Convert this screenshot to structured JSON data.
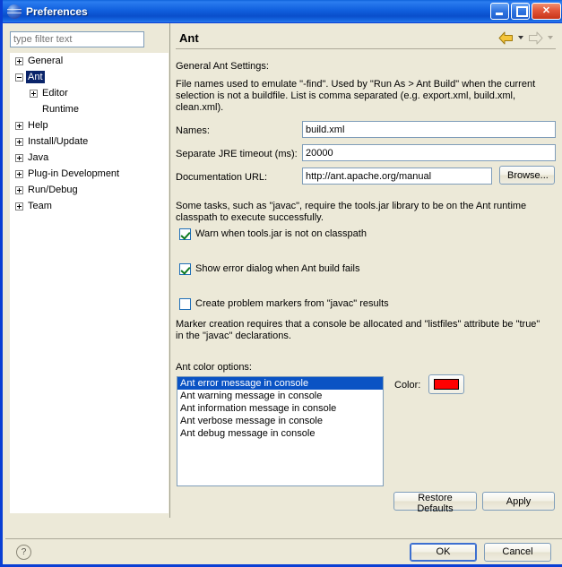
{
  "window": {
    "title": "Preferences",
    "icon": "eclipse-globe-icon",
    "minimize_label": "",
    "maximize_label": "",
    "close_label": "✕",
    "frame_color": "#0A3FD4"
  },
  "sidebar": {
    "filter": {
      "value": "",
      "placeholder": "type filter text"
    },
    "items": [
      {
        "label": "General",
        "state": "collapsed",
        "depth": 0,
        "selected": false
      },
      {
        "label": "Ant",
        "state": "expanded",
        "depth": 0,
        "selected": true
      },
      {
        "label": "Editor",
        "state": "collapsed",
        "depth": 1,
        "selected": false
      },
      {
        "label": "Runtime",
        "state": "leaf",
        "depth": 1,
        "selected": false
      },
      {
        "label": "Help",
        "state": "collapsed",
        "depth": 0,
        "selected": false
      },
      {
        "label": "Install/Update",
        "state": "collapsed",
        "depth": 0,
        "selected": false
      },
      {
        "label": "Java",
        "state": "collapsed",
        "depth": 0,
        "selected": false
      },
      {
        "label": "Plug-in Development",
        "state": "collapsed",
        "depth": 0,
        "selected": false
      },
      {
        "label": "Run/Debug",
        "state": "collapsed",
        "depth": 0,
        "selected": false
      },
      {
        "label": "Team",
        "state": "collapsed",
        "depth": 0,
        "selected": false
      }
    ]
  },
  "page": {
    "title": "Ant",
    "nav": {
      "back_icon": "back-arrow-icon",
      "back_menu_icon": "chevron-down-icon",
      "forward_icon": "forward-arrow-icon",
      "forward_menu_icon": "chevron-down-icon"
    },
    "section_label": "General Ant Settings:",
    "find_description": "File names used to emulate \"-find\". Used by \"Run As > Ant Build\" when the current selection is not a buildfile. List is comma separated (e.g. export.xml, build.xml, clean.xml).",
    "fields": [
      {
        "label": "Names:",
        "value": "build.xml"
      },
      {
        "label": "Separate JRE timeout (ms):",
        "value": "20000"
      },
      {
        "label": "Documentation URL:",
        "value": "http://ant.apache.org/manual"
      }
    ],
    "browse_label": "Browse...",
    "toolsjar_description": "Some tasks, such as \"javac\", require the tools.jar library to be on the Ant runtime classpath to execute successfully.",
    "checkboxes": [
      {
        "label": "Warn when tools.jar is not on classpath",
        "checked": true
      },
      {
        "label": "Show error dialog when Ant build fails",
        "checked": true
      },
      {
        "label": "Create problem markers from \"javac\" results",
        "checked": false
      }
    ],
    "marker_description": "Marker creation requires that a console be allocated and \"listfiles\" attribute be \"true\" in the \"javac\" declarations.",
    "color_options_label": "Ant color options:",
    "color_options": [
      {
        "label": "Ant error message in console",
        "selected": true
      },
      {
        "label": "Ant warning message in console",
        "selected": false
      },
      {
        "label": "Ant information message in console",
        "selected": false
      },
      {
        "label": "Ant verbose message in console",
        "selected": false
      },
      {
        "label": "Ant debug message in console",
        "selected": false
      }
    ],
    "color_label": "Color:",
    "color_value": "#FF0000",
    "restore_defaults_label": "Restore Defaults",
    "apply_label": "Apply"
  },
  "footer": {
    "help_icon": "help-question-icon",
    "help_glyph": "?",
    "ok_label": "OK",
    "cancel_label": "Cancel"
  }
}
